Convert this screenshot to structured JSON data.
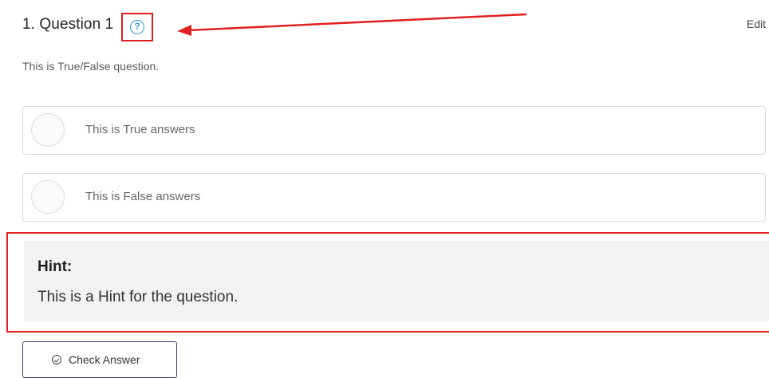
{
  "question": {
    "title": "1. Question 1",
    "help_icon": "?",
    "edit_label": "Edit",
    "description": "This is True/False question."
  },
  "options": [
    {
      "label": "This is True answers"
    },
    {
      "label": "This is False answers"
    }
  ],
  "hint": {
    "title": "Hint:",
    "text": "This is a Hint for the question."
  },
  "check_button": {
    "label": "Check Answer",
    "icon": "check-circle-icon"
  },
  "colors": {
    "annotation_red": "#e02020",
    "help_icon_blue": "#2f9bd9",
    "hint_background": "#f2f2f2",
    "button_border": "#3d3d6b"
  }
}
